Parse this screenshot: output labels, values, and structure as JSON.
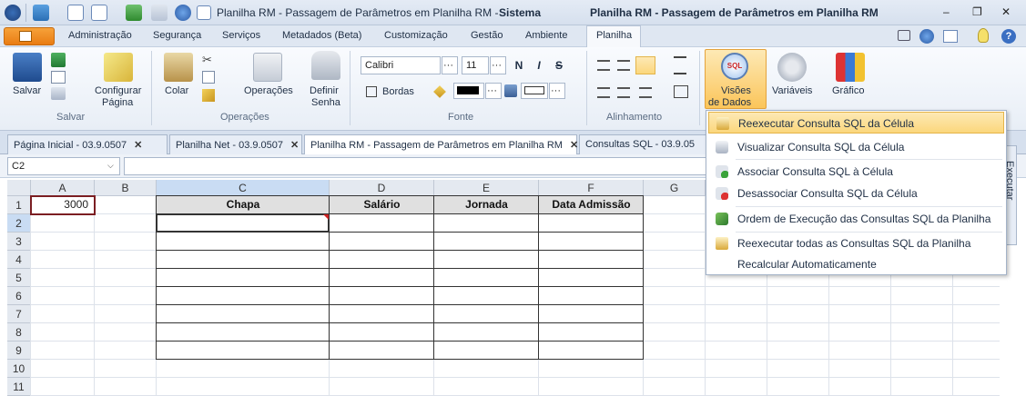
{
  "titlebar": {
    "doc_title": "Planilha RM - Passagem de Parâmetros em Planilha RM -",
    "context_title": "Sistema",
    "app_title": "Planilha RM - Passagem de Parâmetros em Planilha RM",
    "min_glyph": "–",
    "restore_glyph": "❐",
    "close_glyph": "✕"
  },
  "menubar": {
    "tabs": [
      "Administração",
      "Segurança",
      "Serviços",
      "Metadados (Beta)",
      "Customização",
      "Gestão",
      "Ambiente",
      "Planilha"
    ],
    "help_glyph": "?"
  },
  "ribbon": {
    "salvar": {
      "salvar_label": "Salvar",
      "configurar_label1": "Configurar",
      "configurar_label2": "Página",
      "group": "Salvar"
    },
    "operacoes": {
      "colar": "Colar",
      "operacoes": "Operações",
      "definir1": "Definir",
      "definir2": "Senha",
      "group": "Operações"
    },
    "fonte": {
      "font_name": "Calibri",
      "font_size": "11",
      "bold": "N",
      "italic": "I",
      "strike": "S",
      "bordas": "Bordas",
      "group": "Fonte",
      "dots": "···"
    },
    "alinhamento": {
      "group": "Alinhamento"
    },
    "dados": {
      "visoes1": "Visões",
      "visoes2": "de Dados",
      "variaveis": "Variáveis",
      "grafico": "Gráfico",
      "sql_badge": "SQL"
    }
  },
  "doctabs": [
    {
      "label": "Página Inicial - 03.9.0507"
    },
    {
      "label": "Planilha Net - 03.9.0507"
    },
    {
      "label": "Planilha RM - Passagem de Parâmetros em Planilha RM"
    },
    {
      "label": "Consultas SQL - 03.9.05"
    }
  ],
  "tab_close": "✕",
  "formula": {
    "namebox": "C2",
    "value": ""
  },
  "sheet": {
    "columns": [
      "A",
      "B",
      "C",
      "D",
      "E",
      "F",
      "G"
    ],
    "rows": [
      "1",
      "2",
      "3",
      "4",
      "5",
      "6",
      "7",
      "8",
      "9",
      "10",
      "11"
    ],
    "a1": "3000",
    "headers": [
      "Chapa",
      "Salário",
      "Jornada",
      "Data Admissão"
    ]
  },
  "dropdown_menu": {
    "items": [
      "Reexecutar Consulta SQL da Célula",
      "Visualizar Consulta SQL da Célula",
      "Associar Consulta SQL à Célula",
      "Desassociar Consulta SQL da Célula",
      "Ordem de Execução das Consultas SQL da Planilha",
      "Reexecutar todas as Consultas SQL da Planilha",
      "Recalcular Automaticamente"
    ]
  },
  "side_panel": {
    "label": "Executar"
  },
  "colors": {
    "accent": "#e97c13",
    "selection": "#c9dcf3",
    "menu_highlight": "#fbd77c"
  }
}
